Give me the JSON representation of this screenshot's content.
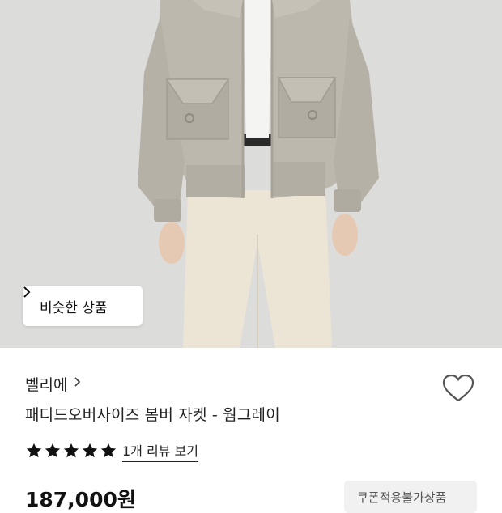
{
  "product_image": {
    "similar_button_label": "비슷한 상품",
    "similar_button_icon": "chevron-right-icon"
  },
  "product": {
    "brand": "벨리에",
    "brand_icon": "chevron-right-icon",
    "title": "패디드오버사이즈 봄버 자켓 - 웜그레이",
    "wishlist_icon": "heart-outline-icon",
    "rating_stars": 5,
    "review_link": "1개 리뷰 보기",
    "price": "187,000원",
    "coupon_badge": "쿠폰적용불가상품"
  },
  "colors": {
    "photo_background": "#dcdcdb",
    "jacket": "#bdb8ae",
    "pants": "#ece5d6",
    "star": "#111111"
  }
}
